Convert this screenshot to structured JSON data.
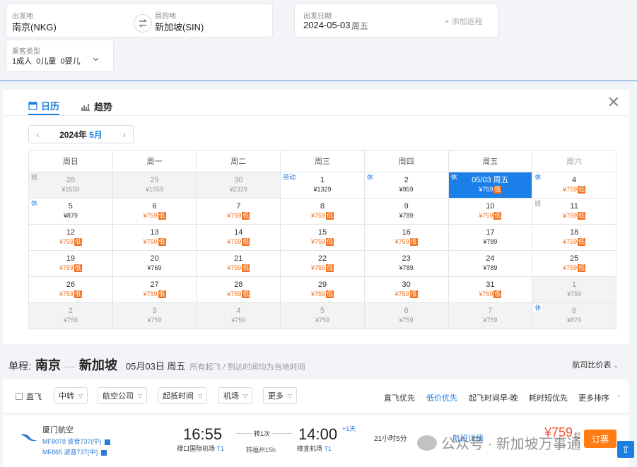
{
  "search": {
    "from_label": "出发地",
    "from_value": "南京(NKG)",
    "to_label": "目的地",
    "to_value": "新加坡(SIN)",
    "date_label": "出发日期",
    "date_value": "2024-05-03",
    "date_weekday": "周五",
    "add_return": "+ 添加返程",
    "pax_label": "乘客类型",
    "pax_value": "1成人  0儿童  0婴儿"
  },
  "tabs": [
    {
      "label": "日历",
      "icon": "calendar-icon",
      "active": true
    },
    {
      "label": "趋势",
      "icon": "trend-chart-icon",
      "active": false
    }
  ],
  "month_nav": {
    "year": "2024年",
    "month": "5月"
  },
  "calendar": {
    "weekdays": [
      "周日",
      "周一",
      "周二",
      "周三",
      "周四",
      "周五",
      "周六"
    ],
    "low_label": "低",
    "weeks": [
      [
        {
          "day": "28",
          "price": "¥1559",
          "dim": true,
          "tag": "班"
        },
        {
          "day": "29",
          "price": "¥1959",
          "dim": true
        },
        {
          "day": "30",
          "price": "¥2329",
          "dim": true
        },
        {
          "day": "1",
          "price": "¥1329",
          "tag": "劳动"
        },
        {
          "day": "2",
          "price": "¥959",
          "tag": "休"
        },
        {
          "day": "05/03 周五",
          "price": "¥759",
          "low": true,
          "selected": true,
          "tag": "休"
        },
        {
          "day": "4",
          "price": "¥759",
          "low": true,
          "tag": "休"
        }
      ],
      [
        {
          "day": "5",
          "price": "¥879",
          "tag": "休"
        },
        {
          "day": "6",
          "price": "¥759",
          "low": true
        },
        {
          "day": "7",
          "price": "¥759",
          "low": true
        },
        {
          "day": "8",
          "price": "¥759",
          "low": true
        },
        {
          "day": "9",
          "price": "¥789"
        },
        {
          "day": "10",
          "price": "¥759",
          "low": true
        },
        {
          "day": "11",
          "price": "¥759",
          "low": true,
          "tag": "班"
        }
      ],
      [
        {
          "day": "12",
          "price": "¥759",
          "low": true
        },
        {
          "day": "13",
          "price": "¥759",
          "low": true
        },
        {
          "day": "14",
          "price": "¥759",
          "low": true
        },
        {
          "day": "15",
          "price": "¥759",
          "low": true
        },
        {
          "day": "16",
          "price": "¥759",
          "low": true
        },
        {
          "day": "17",
          "price": "¥789"
        },
        {
          "day": "18",
          "price": "¥759",
          "low": true
        }
      ],
      [
        {
          "day": "19",
          "price": "¥759",
          "low": true
        },
        {
          "day": "20",
          "price": "¥769"
        },
        {
          "day": "21",
          "price": "¥759",
          "low": true
        },
        {
          "day": "22",
          "price": "¥759",
          "low": true
        },
        {
          "day": "23",
          "price": "¥789"
        },
        {
          "day": "24",
          "price": "¥789"
        },
        {
          "day": "25",
          "price": "¥759",
          "low": true
        }
      ],
      [
        {
          "day": "26",
          "price": "¥759",
          "low": true
        },
        {
          "day": "27",
          "price": "¥759",
          "low": true
        },
        {
          "day": "28",
          "price": "¥759",
          "low": true
        },
        {
          "day": "29",
          "price": "¥759",
          "low": true
        },
        {
          "day": "30",
          "price": "¥759",
          "low": true
        },
        {
          "day": "31",
          "price": "¥759",
          "low": true
        },
        {
          "day": "1",
          "price": "¥759",
          "dim": true
        }
      ],
      [
        {
          "day": "2",
          "price": "¥759",
          "dim": true
        },
        {
          "day": "3",
          "price": "¥759",
          "dim": true
        },
        {
          "day": "4",
          "price": "¥759",
          "dim": true
        },
        {
          "day": "5",
          "price": "¥759",
          "dim": true
        },
        {
          "day": "6",
          "price": "¥759",
          "dim": true
        },
        {
          "day": "7",
          "price": "¥759",
          "dim": true
        },
        {
          "day": "8",
          "price": "¥879",
          "dim": true,
          "tag": "休"
        }
      ]
    ]
  },
  "route": {
    "kind": "单程:",
    "from_city": "南京",
    "to_city": "新加坡",
    "date": "05月03日 周五",
    "note": "所有起飞 / 到达时间均为当地时间",
    "compare_label": "航司比价表"
  },
  "filters": {
    "direct_label": "直飞",
    "dropdowns": [
      "中转",
      "航空公司",
      "起抵时间",
      "机场",
      "更多"
    ],
    "sorts": [
      {
        "label": "直飞优先",
        "active": false
      },
      {
        "label": "低价优先",
        "active": true
      },
      {
        "label": "起飞时间早-晚",
        "active": false
      },
      {
        "label": "耗时短优先",
        "active": false
      },
      {
        "label": "更多排序",
        "active": false
      }
    ]
  },
  "flight": {
    "airline": "厦门航空",
    "flight_numbers": [
      "MF8078 波音737(中)",
      "MF865 波音737(中)"
    ],
    "dep_time": "16:55",
    "dep_airport": "禄口国际机场",
    "dep_terminal": "T1",
    "stop_label": "转1次",
    "stop_detail": "转福州15h",
    "arr_time": "14:00",
    "plus_day": "+1天",
    "arr_airport": "樟宜机场",
    "arr_terminal": "T1",
    "duration": "21小时5分",
    "detail_link": "航班详情",
    "price": "¥759",
    "price_suffix": "起",
    "book_label": "订票"
  },
  "watermark": "公众号 · 新加坡万事通",
  "colors": {
    "accent": "#1a80e0",
    "low_price": "#f0701e",
    "book": "#ff7d13",
    "price": "#f0502e"
  }
}
